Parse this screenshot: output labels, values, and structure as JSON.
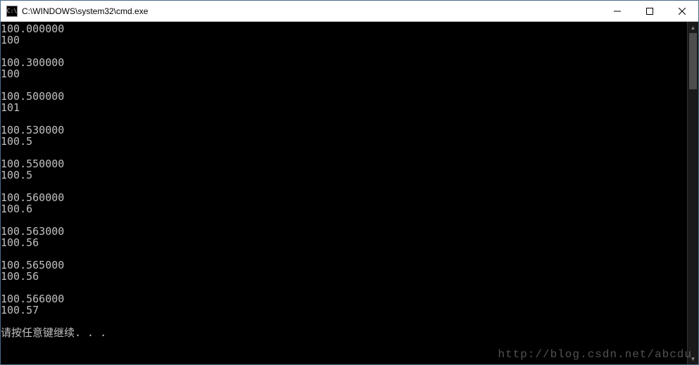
{
  "window": {
    "title": "C:\\WINDOWS\\system32\\cmd.exe",
    "icon_label": "C:\\"
  },
  "console": {
    "lines": [
      "100.000000",
      "100",
      "",
      "100.300000",
      "100",
      "",
      "100.500000",
      "101",
      "",
      "100.530000",
      "100.5",
      "",
      "100.550000",
      "100.5",
      "",
      "100.560000",
      "100.6",
      "",
      "100.563000",
      "100.56",
      "",
      "100.565000",
      "100.56",
      "",
      "100.566000",
      "100.57",
      "",
      "请按任意键继续. . ."
    ]
  },
  "watermark": "http://blog.csdn.net/abcdu"
}
